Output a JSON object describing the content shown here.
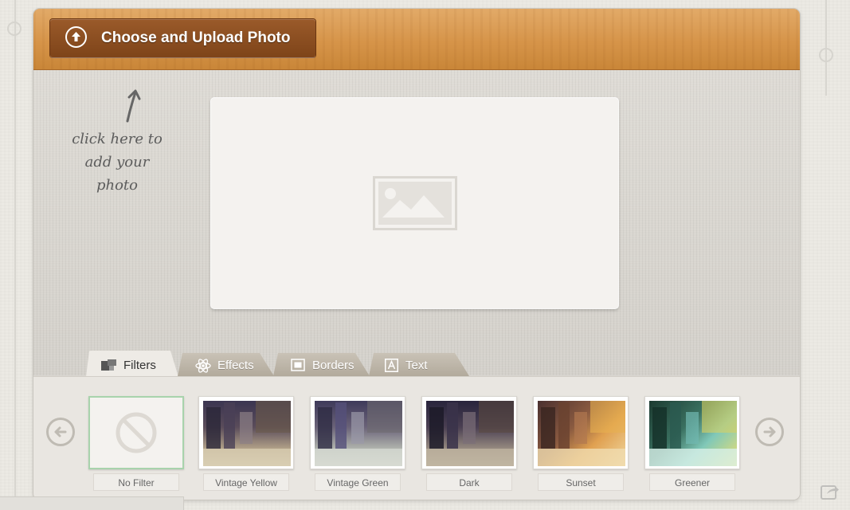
{
  "header": {
    "upload_button_label": "Choose and Upload Photo"
  },
  "hint": {
    "line1": "click here to",
    "line2": "add your photo"
  },
  "tabs": [
    {
      "label": "Filters",
      "icon": "filters-icon",
      "active": true
    },
    {
      "label": "Effects",
      "icon": "atom-icon",
      "active": false
    },
    {
      "label": "Borders",
      "icon": "border-frame-icon",
      "active": false
    },
    {
      "label": "Text",
      "icon": "text-a-icon",
      "active": false
    }
  ],
  "filters": [
    {
      "label": "No Filter",
      "selected": true
    },
    {
      "label": "Vintage Yellow",
      "selected": false
    },
    {
      "label": "Vintage Green",
      "selected": false
    },
    {
      "label": "Dark",
      "selected": false
    },
    {
      "label": "Sunset",
      "selected": false
    },
    {
      "label": "Greener",
      "selected": false
    }
  ],
  "colors": {
    "header_wood": "#d79548",
    "upload_button": "#8a4d20",
    "selected_filter_border": "#a8d3ac"
  }
}
